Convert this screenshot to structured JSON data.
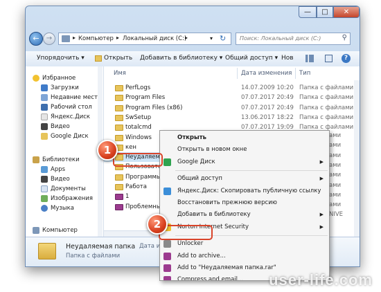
{
  "address": {
    "path": [
      "Компьютер",
      "Локальный диск (C:)"
    ],
    "search_placeholder": "Поиск: Локальный диск (C:)"
  },
  "window_controls": {
    "minimize": "—",
    "maximize": "□",
    "close": "✕"
  },
  "toolbar": {
    "organize": "Упорядочить ▾",
    "open": "Открыть",
    "add_to_library": "Добавить в библиотеку ▾",
    "share": "Общий доступ ▾",
    "new_folder": "Нов"
  },
  "nav": {
    "favorites": {
      "label": "Избранное",
      "items": [
        "Загрузки",
        "Недавние места",
        "Рабочий стол",
        "Яндекс.Диск",
        "Видео",
        "Google Диск"
      ]
    },
    "libraries": {
      "label": "Библиотеки",
      "items": [
        "Apps",
        "Видео",
        "Документы",
        "Изображения",
        "Музыка"
      ]
    },
    "computer": "Компьютер"
  },
  "columns": {
    "name": "Имя",
    "date": "Дата изменения",
    "type": "Тип"
  },
  "files": [
    {
      "name": "PerfLogs",
      "date": "14.07.2009 10:20",
      "type": "Папка с файлами"
    },
    {
      "name": "Program Files",
      "date": "07.07.2017 20:49",
      "type": "Папка с файлами"
    },
    {
      "name": "Program Files (x86)",
      "date": "07.07.2017 20:49",
      "type": "Папка с файлами"
    },
    {
      "name": "SwSetup",
      "date": "13.06.2017 18:22",
      "type": "Папка с файлами"
    },
    {
      "name": "totalcmd",
      "date": "07.07.2017 19:09",
      "type": "Папка с файлами"
    },
    {
      "name": "Windows",
      "date": "",
      "type": ""
    },
    {
      "name": "кен",
      "date": "",
      "type": ""
    },
    {
      "name": "Неудаляема",
      "date": "",
      "type": ""
    },
    {
      "name": "Пользовате",
      "date": "",
      "type": ""
    },
    {
      "name": "Программы",
      "date": "",
      "type": ""
    },
    {
      "name": "Работа",
      "date": "",
      "type": ""
    },
    {
      "name": "1",
      "date": "",
      "type": ""
    },
    {
      "name": "Проблемный",
      "date": "",
      "type": ""
    }
  ],
  "right_fragments": [
    "ами",
    "ами",
    "ами",
    "ами",
    "ами",
    "ами",
    "ами",
    "ами",
    "NIVE"
  ],
  "details": {
    "name": "Неудаляемая папка",
    "date_label": "Дата изменен",
    "type": "Папка с файлами"
  },
  "context_menu": {
    "items": [
      {
        "label": "Открыть",
        "bold": true,
        "icon": ""
      },
      {
        "label": "Открыть в новом окне",
        "icon": ""
      },
      {
        "label": "Google Диск",
        "icon": "google-drive-icon",
        "submenu": true
      },
      {
        "sep": true
      },
      {
        "label": "Общий доступ",
        "icon": "",
        "submenu": true
      },
      {
        "label": "Яндекс.Диск: Скопировать публичную ссылку",
        "icon": "yandex-disk-icon"
      },
      {
        "label": "Восстановить прежнюю версию",
        "icon": ""
      },
      {
        "label": "Добавить в библиотеку",
        "icon": "",
        "submenu": true
      },
      {
        "label": "Norton Internet Security",
        "icon": "norton-icon",
        "submenu": true
      },
      {
        "sep": true
      },
      {
        "label": "Unlocker",
        "icon": "unlocker-icon"
      },
      {
        "label": "Add to archive...",
        "icon": "winrar-icon"
      },
      {
        "label": "Add to \"Неудаляемая папка.rar\"",
        "icon": "winrar-icon"
      },
      {
        "label": "Compress and email...",
        "icon": "winrar-icon"
      }
    ]
  },
  "badges": {
    "one": "1",
    "two": "2"
  },
  "watermark": "user-life.com",
  "colors": {
    "accent": "#d9442a",
    "selection": "#cce4f7",
    "folder": "#e7c45a"
  }
}
